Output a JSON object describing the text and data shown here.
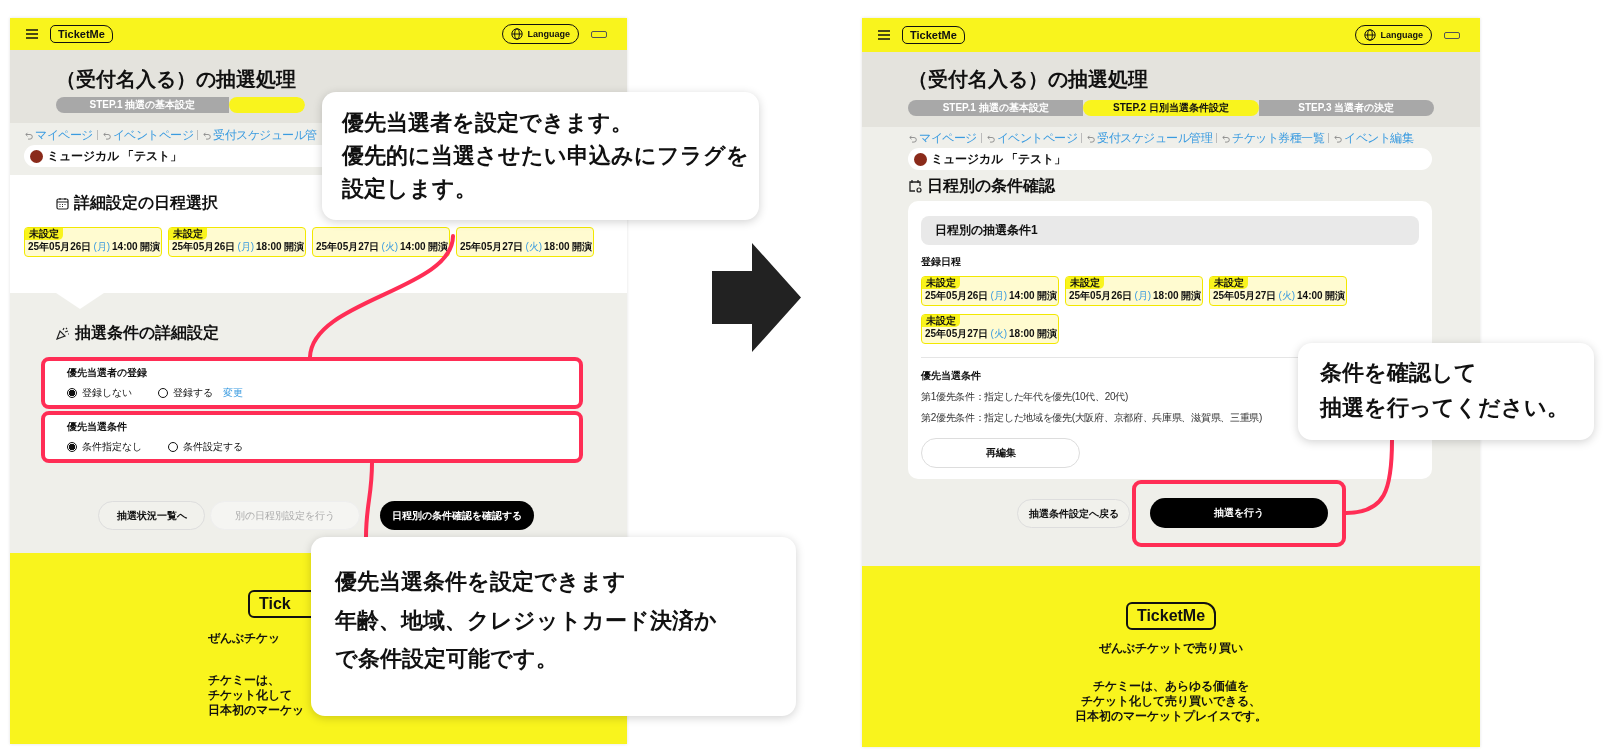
{
  "left_screen": {
    "header": {
      "logo": "TicketMe",
      "language": "Language"
    },
    "title": "（受付名入る）の抽選処理",
    "steps": [
      {
        "label": "STEP.1 抽選の基本設定",
        "selected": false
      },
      {
        "selected": true
      }
    ],
    "breadcrumbs": [
      "マイページ",
      "イベントページ",
      "受付スケジュール管"
    ],
    "event_name": "ミュージカル 「テスト」",
    "schedule_heading": "詳細設定の日程選択",
    "schedules": [
      {
        "status": "未設定",
        "date": "25年05月26日",
        "weekday": "(月)",
        "time": "14:00 開演"
      },
      {
        "status": "未設定",
        "date": "25年05月26日",
        "weekday": "(月)",
        "time": "18:00 開演"
      },
      {
        "date": "25年05月27日",
        "weekday": "(火)",
        "time": "14:00 開演"
      },
      {
        "date": "25年05月27日",
        "weekday": "(火)",
        "time": "18:00 開演"
      }
    ],
    "conditions_heading": "抽選条件の詳細設定",
    "settings": [
      {
        "label": "優先当選者の登録",
        "highlighted": true,
        "options": [
          {
            "label": "登録しない",
            "selected": true
          },
          {
            "label": "登録する",
            "selected": false
          }
        ],
        "link": "変更"
      },
      {
        "label": "優先当選条件",
        "highlighted": true,
        "options": [
          {
            "label": "条件指定なし",
            "selected": true
          },
          {
            "label": "条件設定する",
            "selected": false
          }
        ]
      }
    ],
    "buttons": [
      {
        "label": "抽選状況一覧へ",
        "kind": "outline"
      },
      {
        "label": "別の日程別設定を行う",
        "kind": "disabled"
      },
      {
        "label": "日程別の条件確認を確認する",
        "kind": "primary"
      }
    ],
    "footer": {
      "logo": "Tick",
      "tagline": "ぜんぶチケッ",
      "description": [
        "チケミーは、",
        "チケット化して",
        "日本初のマーケッ"
      ]
    }
  },
  "right_screen": {
    "header": {
      "logo": "TicketMe",
      "language": "Language"
    },
    "title": "（受付名入る）の抽選処理",
    "steps": [
      {
        "label": "STEP.1 抽選の基本設定",
        "selected": false
      },
      {
        "label": "STEP.2 日別当選条件設定",
        "selected": true
      },
      {
        "label": "STEP.3 当選者の決定",
        "selected": false
      }
    ],
    "breadcrumbs": [
      "マイページ",
      "イベントページ",
      "受付スケジュール管理",
      "チケット券種一覧",
      "イベント編集"
    ],
    "event_name": "ミュージカル 「テスト」",
    "heading": "日程別の条件確認",
    "card": {
      "title": "日程別の抽選条件1",
      "schedules_label": "登録日程",
      "schedules": [
        {
          "status": "未設定",
          "date": "25年05月26日",
          "weekday": "(月)",
          "time": "14:00 開演"
        },
        {
          "status": "未設定",
          "date": "25年05月26日",
          "weekday": "(月)",
          "time": "18:00 開演"
        },
        {
          "status": "未設定",
          "date": "25年05月27日",
          "weekday": "(火)",
          "time": "14:00 開演"
        },
        {
          "status": "未設定",
          "date": "25年05月27日",
          "weekday": "(火)",
          "time": "18:00 開演"
        }
      ],
      "conditions_label": "優先当選条件",
      "conditions": [
        "第1優先条件：指定した年代を優先(10代、20代)",
        "第2優先条件：指定した地域を優先(大阪府、京都府、兵庫県、滋賀県、三重県)"
      ],
      "edit_button": "再編集"
    },
    "buttons": [
      {
        "label": "抽選条件設定へ戻る",
        "kind": "outline",
        "highlighted": false
      },
      {
        "label": "抽選を行う",
        "kind": "primary",
        "highlighted": true
      }
    ],
    "footer": {
      "logo": "TicketMe",
      "tagline": "ぜんぶチケットで売り買い",
      "description": [
        "チケミーは、あらゆる価値を",
        "チケット化して売り買いできる、",
        "日本初のマーケットプレイスです。"
      ]
    }
  },
  "callouts": [
    {
      "lines": [
        "優先当選者を設定できます。",
        "優先的に当選させたい申込みにフラグを",
        "設定します。"
      ]
    },
    {
      "lines": [
        "優先当選条件を設定できます",
        "年齢、地域、クレジットカード決済か",
        "で条件設定可能です。"
      ]
    },
    {
      "lines": [
        "条件を確認して",
        "抽選を行ってください。"
      ]
    }
  ]
}
